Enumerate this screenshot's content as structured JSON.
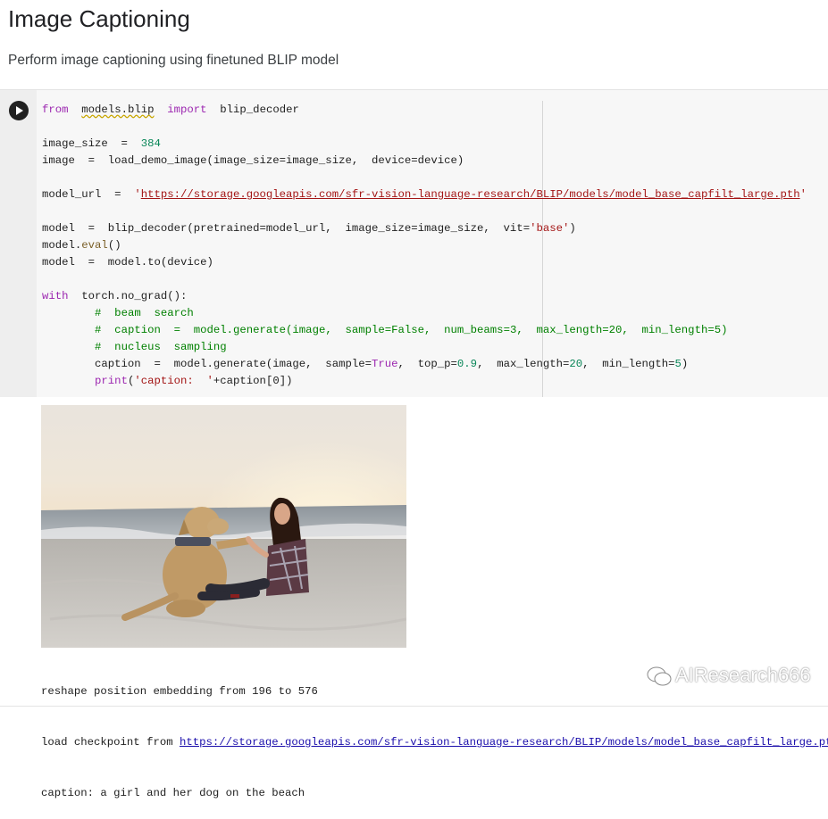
{
  "notebook": {
    "heading": "Image Captioning",
    "subtitle": "Perform image captioning using finetuned BLIP model"
  },
  "code_cell": {
    "run_button_icon": "play-icon",
    "lines": [
      [
        {
          "t": "from",
          "c": "kw"
        },
        {
          "t": "  "
        },
        {
          "t": "models.blip",
          "c": "squig"
        },
        {
          "t": "  "
        },
        {
          "t": "import",
          "c": "kw"
        },
        {
          "t": "  blip_decoder"
        }
      ],
      [],
      [
        {
          "t": "image_size  =  "
        },
        {
          "t": "384",
          "c": "num"
        }
      ],
      [
        {
          "t": "image  =  load_demo_image(image_size=image_size,  device=device)"
        }
      ],
      [],
      [
        {
          "t": "model_url  =  "
        },
        {
          "t": "'",
          "c": "str"
        },
        {
          "t": "https://storage.googleapis.com/sfr-vision-language-research/BLIP/models/model_base_capfilt_large.pth",
          "c": "url"
        },
        {
          "t": "'",
          "c": "str"
        }
      ],
      [],
      [
        {
          "t": "model  =  blip_decoder(pretrained=model_url,  image_size=image_size,  vit="
        },
        {
          "t": "'base'",
          "c": "str"
        },
        {
          "t": ")"
        }
      ],
      [
        {
          "t": "model."
        },
        {
          "t": "eval",
          "c": "fn"
        },
        {
          "t": "()"
        }
      ],
      [
        {
          "t": "model  =  model.to(device)"
        }
      ],
      [],
      [
        {
          "t": "with",
          "c": "kw"
        },
        {
          "t": "  torch.no_grad():"
        }
      ],
      [
        {
          "t": "        "
        },
        {
          "t": "#  beam  search",
          "c": "cm"
        }
      ],
      [
        {
          "t": "        "
        },
        {
          "t": "#  caption  =  model.generate(image,  sample=False,  num_beams=3,  max_length=20,  min_length=5)",
          "c": "cm"
        }
      ],
      [
        {
          "t": "        "
        },
        {
          "t": "#  nucleus  sampling",
          "c": "cm"
        }
      ],
      [
        {
          "t": "        caption  =  model.generate(image,  sample="
        },
        {
          "t": "True",
          "c": "kw"
        },
        {
          "t": ",  top_p="
        },
        {
          "t": "0.9",
          "c": "num"
        },
        {
          "t": ",  max_length="
        },
        {
          "t": "20",
          "c": "num"
        },
        {
          "t": ",  min_length="
        },
        {
          "t": "5",
          "c": "num"
        },
        {
          "t": ")"
        }
      ],
      [
        {
          "t": "        "
        },
        {
          "t": "print",
          "c": "kw"
        },
        {
          "t": "("
        },
        {
          "t": "'caption:  '",
          "c": "str"
        },
        {
          "t": "+caption[0])"
        }
      ]
    ]
  },
  "output": {
    "image_description": "photo of a woman and her dog on the beach",
    "line1": "reshape position embedding from 196 to 576",
    "line2_prefix": "load checkpoint from ",
    "line2_link": "https://storage.googleapis.com/sfr-vision-language-research/BLIP/models/model_base_capfilt_large.pth",
    "line3": "caption: a girl and her dog on the beach"
  },
  "watermark": {
    "icon": "wechat-icon",
    "text": "AIResearch666"
  }
}
